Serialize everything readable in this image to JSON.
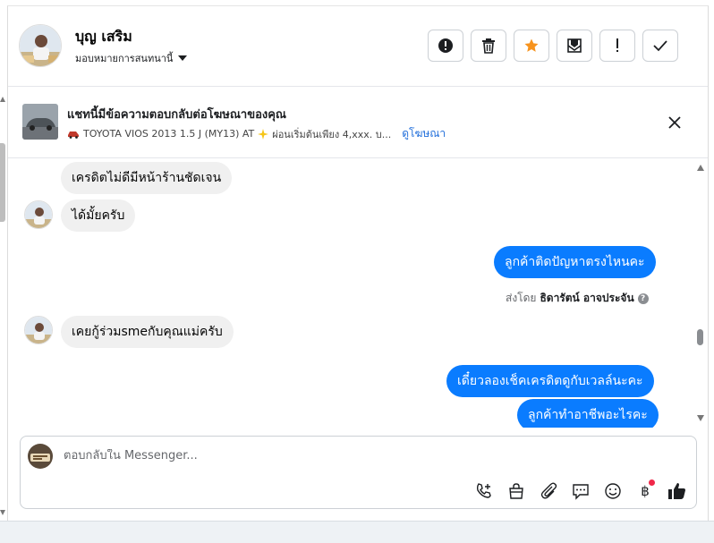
{
  "header": {
    "name": "บุญ เสริม",
    "assign_label": "มอบหมายการสนทนานี้",
    "actions": [
      "mark-spam",
      "delete",
      "star",
      "mark-unread",
      "follow-up",
      "done"
    ]
  },
  "banner": {
    "title": "แชทนี้มีข้อความตอบกลับต่อโฆษณาของคุณ",
    "subtitle": "TOYOTA VIOS 2013 1.5 J (MY13) AT",
    "subtitle_rest": "ผ่อนเริ่มต้นเพียง 4,xxx. บ...",
    "link": "ดูโฆษณา"
  },
  "messages": [
    {
      "dir": "in",
      "text": "เครดิตไม่ดีมีหน้าร้านชัดเจน"
    },
    {
      "dir": "in",
      "text": "ได้มั้ยครับ"
    },
    {
      "dir": "out",
      "text": "ลูกค้าติดปัญหาตรงไหนคะ"
    },
    {
      "dir": "in",
      "text": "เคยกู้ร่วมsmeกับคุณแม่ครับ"
    },
    {
      "dir": "out",
      "text": "เดี๋ยวลองเช็คเครดิตดูกับเวลล์นะคะ"
    },
    {
      "dir": "out",
      "text": "ลูกค้าทำอาชีพอะไรคะ"
    }
  ],
  "sent_by": {
    "prefix": "ส่งโดย",
    "name": "ธิดารัตน์ อาจประจัน"
  },
  "composer": {
    "placeholder": "ตอบกลับใน Messenger...",
    "tools": [
      "call-add",
      "shop",
      "attach",
      "saved-reply",
      "emoji",
      "baht",
      "like"
    ],
    "baht_symbol": "฿"
  },
  "colors": {
    "outgoing": "#0a7cff",
    "incoming": "#f0f0f0",
    "star": "#f7931e",
    "notification_dot": "#f02849"
  }
}
